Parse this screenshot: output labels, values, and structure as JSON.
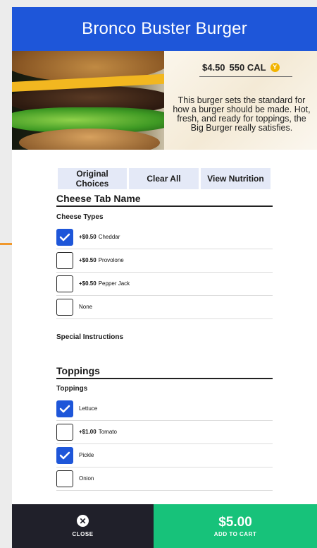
{
  "header": {
    "title": "Bronco Buster Burger"
  },
  "item": {
    "price": "$4.50",
    "calories": "550 CAL",
    "badge": "Y",
    "description": "This burger sets the standard for how a burger should be made. Hot, fresh, and ready for toppings, the Big Burger really satisfies."
  },
  "actions": {
    "original_choices": "Original Choices",
    "clear_all": "Clear All",
    "view_nutrition": "View Nutrition"
  },
  "cheese": {
    "title": "Cheese Tab Name",
    "group_label": "Cheese Types",
    "options": [
      {
        "price": "+$0.50",
        "name": "Cheddar",
        "checked": true
      },
      {
        "price": "+$0.50",
        "name": "Provolone",
        "checked": false
      },
      {
        "price": "+$0.50",
        "name": "Pepper Jack",
        "checked": false
      },
      {
        "price": "",
        "name": "None",
        "checked": false
      }
    ]
  },
  "special_instructions": "Special Instructions",
  "toppings": {
    "title": "Toppings",
    "group_label": "Toppings",
    "options": [
      {
        "price": "",
        "name": "Lettuce",
        "checked": true
      },
      {
        "price": "+$1.00",
        "name": "Tomato",
        "checked": false
      },
      {
        "price": "",
        "name": "Pickle",
        "checked": true
      },
      {
        "price": "",
        "name": "Onion",
        "checked": false
      }
    ]
  },
  "footer": {
    "close_label": "CLOSE",
    "total": "$5.00",
    "add_to_cart_label": "ADD TO CART"
  },
  "colors": {
    "header": "#1e56d9",
    "checked": "#1e56d9",
    "add_to_cart": "#17c27a",
    "close_bar": "#20202a",
    "callout": "#f0982c"
  }
}
